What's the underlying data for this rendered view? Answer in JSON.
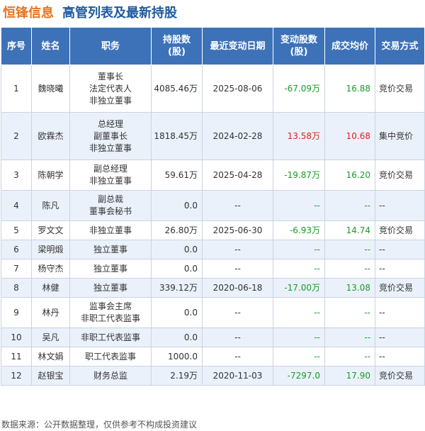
{
  "header": {
    "company": "恒锋信息",
    "subtitle": "高管列表及最新持股"
  },
  "colors": {
    "header_bg": "#3d72b8",
    "company": "#e8741f",
    "subtitle": "#1f5a9e",
    "negative": "#1a9a2a",
    "positive": "#e02020",
    "alt_row": "#eaf1fa"
  },
  "table": {
    "headers": {
      "no": "序号",
      "name": "姓名",
      "position": "职务",
      "shares_l1": "持股数",
      "shares_l2": "(股)",
      "date": "最近变动日期",
      "change_l1": "变动股数",
      "change_l2": "(股)",
      "price": "成交均价",
      "method": "交易方式"
    },
    "rows": [
      {
        "no": "1",
        "name": "魏晓曦",
        "pos1": "董事长",
        "pos2": "法定代表人",
        "pos3": "非独立董事",
        "shares": "4085.46万",
        "date": "2025-08-06",
        "change": "-67.09万",
        "price": "16.88",
        "method": "竞价交易"
      },
      {
        "no": "2",
        "name": "欧霖杰",
        "pos1": "总经理",
        "pos2": "副董事长",
        "pos3": "非独立董事",
        "shares": "1818.45万",
        "date": "2024-02-28",
        "change": "13.58万",
        "price": "10.68",
        "method": "集中竞价"
      },
      {
        "no": "3",
        "name": "陈朝学",
        "pos1": "副总经理",
        "pos2": "非独立董事",
        "shares": "59.61万",
        "date": "2025-04-28",
        "change": "-19.87万",
        "price": "16.20",
        "method": "竞价交易"
      },
      {
        "no": "4",
        "name": "陈凡",
        "pos1": "副总裁",
        "pos2": "董事会秘书",
        "shares": "0.0",
        "date": "--",
        "change": "--",
        "price": "--",
        "method": "--"
      },
      {
        "no": "5",
        "name": "罗文文",
        "pos1": "非独立董事",
        "shares": "26.80万",
        "date": "2025-06-30",
        "change": "-6.93万",
        "price": "14.74",
        "method": "竞价交易"
      },
      {
        "no": "6",
        "name": "梁明煅",
        "pos1": "独立董事",
        "shares": "0.0",
        "date": "--",
        "change": "--",
        "price": "--",
        "method": "--"
      },
      {
        "no": "7",
        "name": "杨守杰",
        "pos1": "独立董事",
        "shares": "0.0",
        "date": "--",
        "change": "--",
        "price": "--",
        "method": "--"
      },
      {
        "no": "8",
        "name": "林健",
        "pos1": "独立董事",
        "shares": "339.12万",
        "date": "2020-06-18",
        "change": "-17.00万",
        "price": "13.08",
        "method": "竞价交易"
      },
      {
        "no": "9",
        "name": "林丹",
        "pos1": "监事会主席",
        "pos2": "非职工代表监事",
        "shares": "0.0",
        "date": "--",
        "change": "--",
        "price": "--",
        "method": "--"
      },
      {
        "no": "10",
        "name": "吴凡",
        "pos1": "非职工代表监事",
        "shares": "0.0",
        "date": "--",
        "change": "--",
        "price": "--",
        "method": "--"
      },
      {
        "no": "11",
        "name": "林文娟",
        "pos1": "职工代表监事",
        "shares": "1000.0",
        "date": "--",
        "change": "--",
        "price": "--",
        "method": "--"
      },
      {
        "no": "12",
        "name": "赵银宝",
        "pos1": "财务总监",
        "shares": "2.19万",
        "date": "2020-11-03",
        "change": "-7297.0",
        "price": "17.90",
        "method": "竞价交易"
      }
    ]
  },
  "footer": {
    "source": "数据来源：公开数据整理，仅供参考不构成投资建议"
  }
}
